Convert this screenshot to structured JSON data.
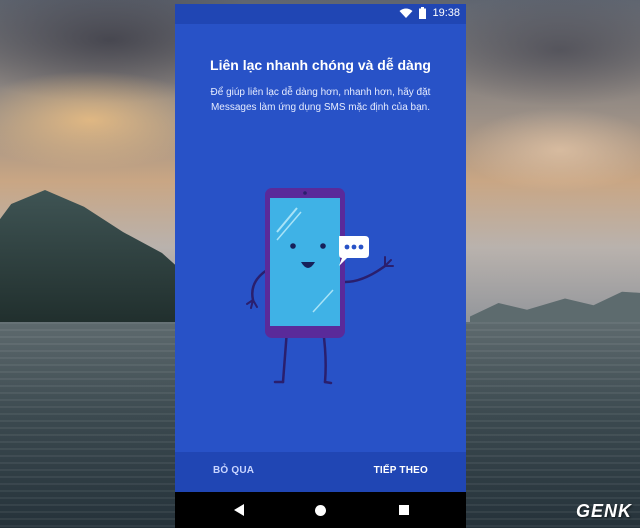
{
  "status_bar": {
    "time": "19:38"
  },
  "onboarding": {
    "title": "Liên lạc nhanh chóng và dễ dàng",
    "description": "Để giúp liên lạc dễ dàng hơn, nhanh hơn, hãy đặt Messages làm ứng dụng SMS mặc định của bạn.",
    "illustration_icon": "waving-phone-character-icon"
  },
  "footer": {
    "skip_label": "BỎ QUA",
    "next_label": "TIẾP THEO"
  },
  "nav_bar": {
    "back_icon": "back-triangle-icon",
    "home_icon": "home-circle-icon",
    "recent_icon": "recent-square-icon"
  },
  "watermark": "GENK",
  "colors": {
    "accent": "#2852c7",
    "status_bar": "#2046b4",
    "phone_body": "#5a2a9a",
    "phone_screen": "#3fb2e6"
  }
}
